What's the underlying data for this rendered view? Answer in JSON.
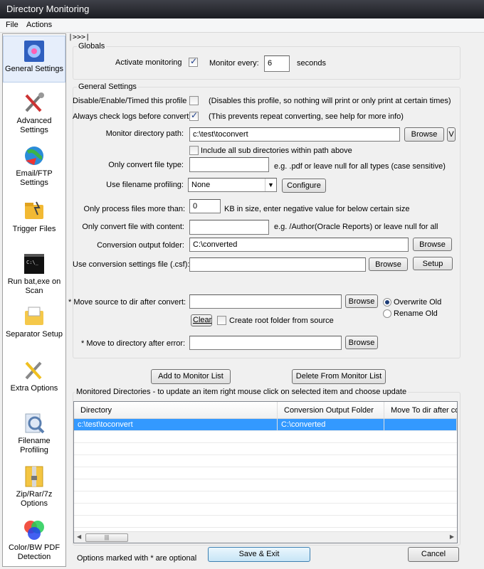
{
  "window": {
    "title": "Directory Monitoring"
  },
  "menu": {
    "file": "File",
    "actions": "Actions"
  },
  "collapse_label": "|>>>|",
  "sidebar": {
    "items": [
      {
        "label": "General Settings",
        "icon": "general-settings-icon"
      },
      {
        "label": "Advanced Settings",
        "icon": "tools-icon"
      },
      {
        "label": "Email/FTP Settings",
        "icon": "globe-icon"
      },
      {
        "label": "Trigger Files",
        "icon": "trigger-files-icon"
      },
      {
        "label": "Run bat,exe on Scan",
        "icon": "terminal-icon"
      },
      {
        "label": "Separator Setup",
        "icon": "separator-icon"
      },
      {
        "label": "Extra Options",
        "icon": "extra-options-icon"
      },
      {
        "label": "Filename Profiling",
        "icon": "magnifier-icon"
      },
      {
        "label": "Zip/Rar/7z Options",
        "icon": "archive-icon"
      },
      {
        "label": "Color/BW PDF Detection",
        "icon": "color-wheel-icon"
      }
    ]
  },
  "globals": {
    "title": "Globals",
    "activate_label": "Activate monitoring",
    "activate_checked": true,
    "monitor_every_label": "Monitor every:",
    "monitor_every_value": "6",
    "seconds_label": "seconds"
  },
  "general": {
    "title": "General Settings",
    "disable_label": "Disable/Enable/Timed this profile",
    "disable_checked": false,
    "disable_note": "(Disables this profile, so nothing will print or only print at certain times)",
    "check_logs_label": "Always check logs before convert",
    "check_logs_checked": true,
    "check_logs_note": "(This prevents repeat converting, see help for more info)",
    "monitor_path_label": "Monitor directory path:",
    "monitor_path_value": "c:\\test\\toconvert",
    "browse_label": "Browse",
    "v_label": "V",
    "include_subdirs_label": "Include all sub directories within path above",
    "include_subdirs_checked": false,
    "file_type_label": "Only convert file type:",
    "file_type_value": "",
    "file_type_note": "e.g. .pdf or leave null for all types (case sensitive)",
    "filename_profiling_label": "Use filename profiling:",
    "filename_profiling_value": "None",
    "configure_label": "Configure",
    "min_size_label": "Only process files more than:",
    "min_size_value": "0",
    "min_size_note": "KB in size, enter negative value for below certain size",
    "content_label": "Only convert file with content:",
    "content_value": "",
    "content_note": "e.g. /Author(Oracle Reports) or leave null for all",
    "output_folder_label": "Conversion output folder:",
    "output_folder_value": "C:\\converted",
    "csf_label": "Use conversion settings file (.csf):",
    "csf_value": "",
    "setup_label": "Setup",
    "move_source_label": "*  Move source to dir after convert:",
    "move_source_value": "",
    "overwrite_label": "Overwrite Old",
    "overwrite_checked": true,
    "rename_label": "Rename Old",
    "rename_checked": false,
    "clear_label": "Clear",
    "create_root_label": "Create root folder from source",
    "create_root_checked": false,
    "move_error_label": "*  Move to directory after error:",
    "move_error_value": ""
  },
  "actions": {
    "add_label": "Add to Monitor List",
    "delete_label": "Delete From Monitor List"
  },
  "monitored": {
    "title": "Monitored Directories   -   to update an item right mouse click on selected item and choose update",
    "columns": [
      "Directory",
      "Conversion Output Folder",
      "Move To dir after convert"
    ],
    "rows": [
      [
        "c:\\test\\toconvert",
        "C:\\converted",
        ""
      ]
    ]
  },
  "footer": {
    "optional_note": "Options marked with * are optional",
    "save_label": "Save & Exit",
    "cancel_label": "Cancel"
  }
}
